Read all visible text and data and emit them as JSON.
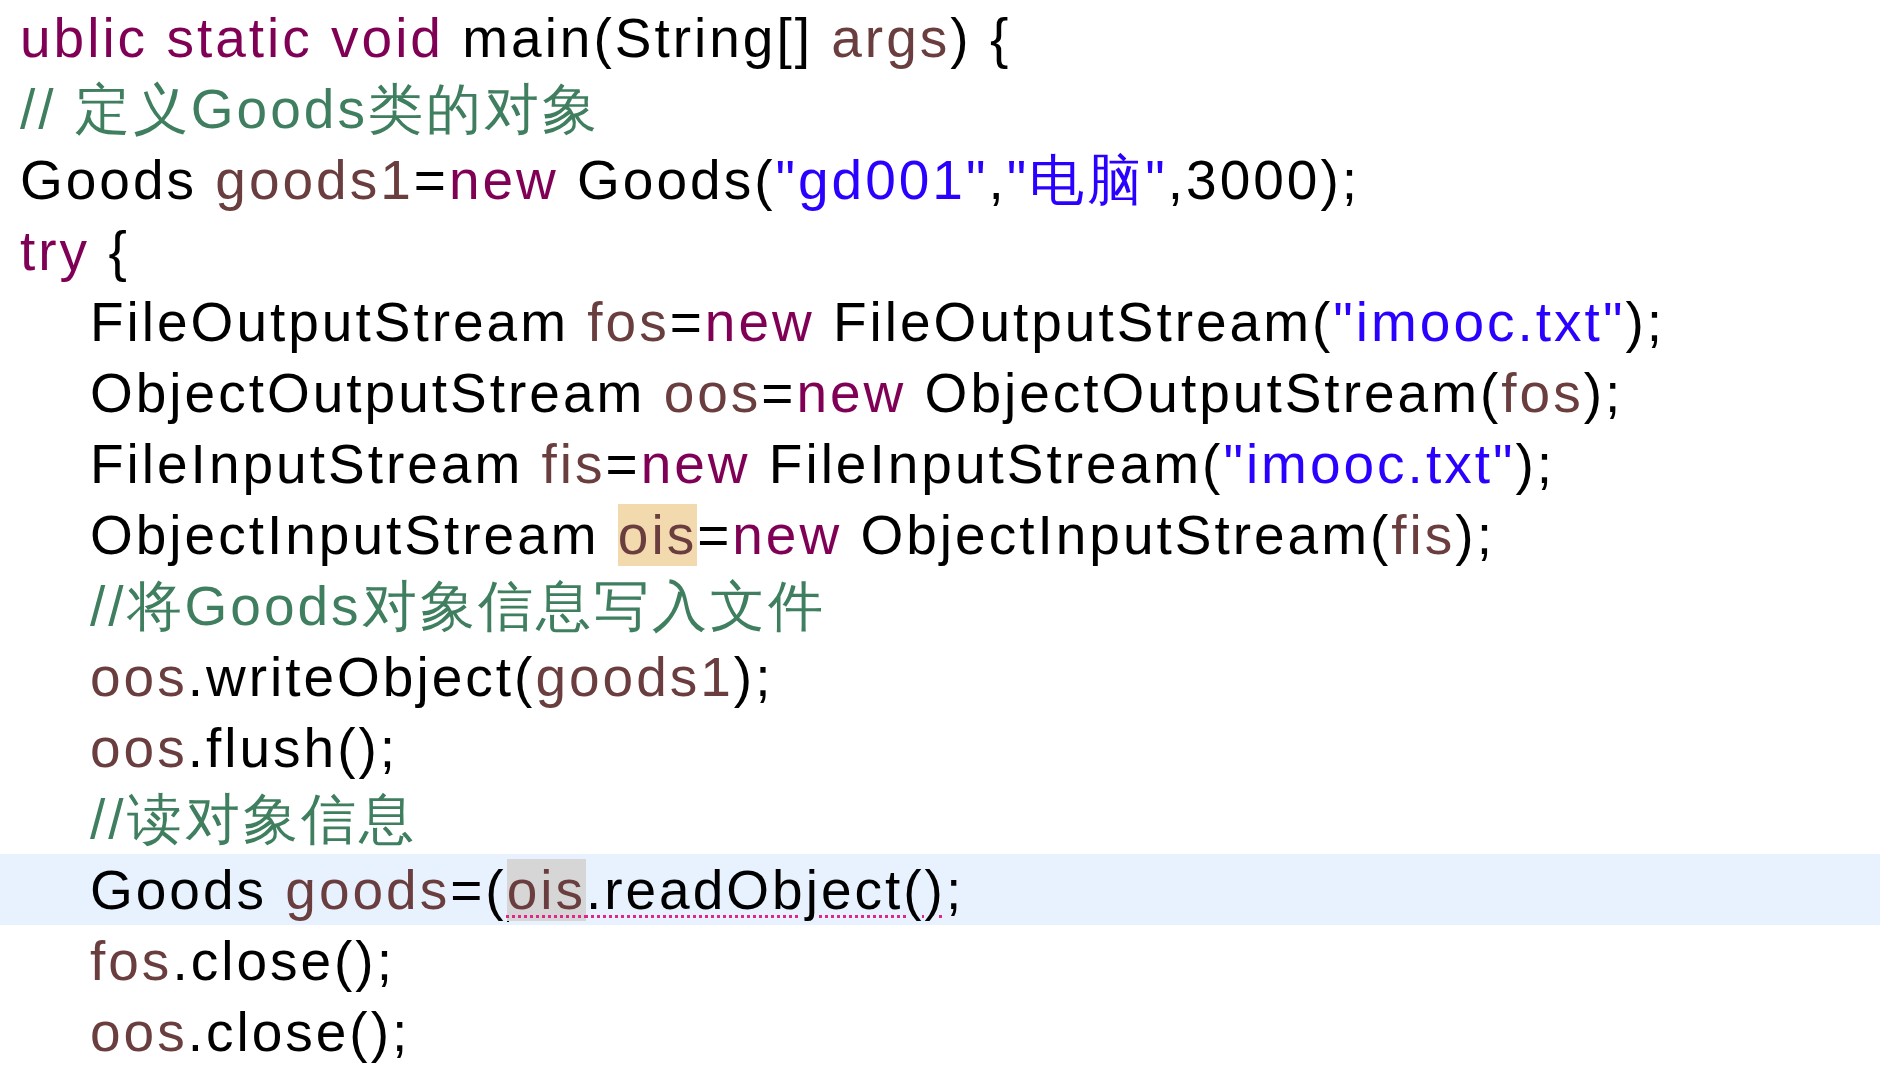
{
  "lines": [
    {
      "current": false,
      "tokens": [
        {
          "kind": "keyword",
          "text": "ublic static void"
        },
        {
          "kind": "plain",
          "text": " main(String[] "
        },
        {
          "kind": "variable",
          "text": "args"
        },
        {
          "kind": "plain",
          "text": ") {"
        }
      ]
    },
    {
      "current": false,
      "tokens": [
        {
          "kind": "comment",
          "text": "// 定义Goods类的对象"
        }
      ]
    },
    {
      "current": false,
      "tokens": [
        {
          "kind": "plain",
          "text": "Goods "
        },
        {
          "kind": "variable",
          "text": "goods1"
        },
        {
          "kind": "plain",
          "text": "="
        },
        {
          "kind": "keyword",
          "text": "new"
        },
        {
          "kind": "plain",
          "text": " Goods("
        },
        {
          "kind": "string",
          "text": "\"gd001\""
        },
        {
          "kind": "plain",
          "text": ","
        },
        {
          "kind": "string",
          "text": "\"电脑\""
        },
        {
          "kind": "plain",
          "text": ",3000);"
        }
      ]
    },
    {
      "current": false,
      "tokens": [
        {
          "kind": "keyword",
          "text": "try"
        },
        {
          "kind": "plain",
          "text": " {"
        }
      ],
      "children": [
        {
          "current": false,
          "tokens": [
            {
              "kind": "plain",
              "text": "FileOutputStream "
            },
            {
              "kind": "variable",
              "text": "fos"
            },
            {
              "kind": "plain",
              "text": "="
            },
            {
              "kind": "keyword",
              "text": "new"
            },
            {
              "kind": "plain",
              "text": " FileOutputStream("
            },
            {
              "kind": "string",
              "text": "\"imooc.txt\""
            },
            {
              "kind": "plain",
              "text": ");"
            }
          ]
        },
        {
          "current": false,
          "tokens": [
            {
              "kind": "plain",
              "text": "ObjectOutputStream "
            },
            {
              "kind": "variable",
              "text": "oos"
            },
            {
              "kind": "plain",
              "text": "="
            },
            {
              "kind": "keyword",
              "text": "new"
            },
            {
              "kind": "plain",
              "text": " ObjectOutputStream("
            },
            {
              "kind": "variable",
              "text": "fos"
            },
            {
              "kind": "plain",
              "text": ");"
            }
          ]
        },
        {
          "current": false,
          "tokens": [
            {
              "kind": "plain",
              "text": "FileInputStream "
            },
            {
              "kind": "variable",
              "text": "fis"
            },
            {
              "kind": "plain",
              "text": "="
            },
            {
              "kind": "keyword",
              "text": "new"
            },
            {
              "kind": "plain",
              "text": " FileInputStream("
            },
            {
              "kind": "string",
              "text": "\"imooc.txt\""
            },
            {
              "kind": "plain",
              "text": ");"
            }
          ]
        },
        {
          "current": false,
          "tokens": [
            {
              "kind": "plain",
              "text": "ObjectInputStream "
            },
            {
              "kind": "occurrence",
              "text": "ois"
            },
            {
              "kind": "plain",
              "text": "="
            },
            {
              "kind": "keyword",
              "text": "new"
            },
            {
              "kind": "plain",
              "text": " ObjectInputStream("
            },
            {
              "kind": "variable",
              "text": "fis"
            },
            {
              "kind": "plain",
              "text": ");"
            }
          ]
        },
        {
          "current": false,
          "tokens": [
            {
              "kind": "comment",
              "text": "//将Goods对象信息写入文件"
            }
          ]
        },
        {
          "current": false,
          "tokens": [
            {
              "kind": "variable",
              "text": "oos"
            },
            {
              "kind": "plain",
              "text": ".writeObject("
            },
            {
              "kind": "variable",
              "text": "goods1"
            },
            {
              "kind": "plain",
              "text": ");"
            }
          ]
        },
        {
          "current": false,
          "tokens": [
            {
              "kind": "variable",
              "text": "oos"
            },
            {
              "kind": "plain",
              "text": ".flush();"
            }
          ]
        },
        {
          "current": false,
          "tokens": [
            {
              "kind": "comment",
              "text": "//读对象信息"
            }
          ]
        },
        {
          "current": true,
          "tokens": [
            {
              "kind": "plain",
              "text": "Goods "
            },
            {
              "kind": "variable",
              "text": "goods"
            },
            {
              "kind": "plain",
              "text": "=("
            },
            {
              "kind": "caret"
            },
            {
              "kind": "error",
              "tokens": [
                {
                  "kind": "selection",
                  "text": "ois"
                },
                {
                  "kind": "plain",
                  "text": ".readObject()"
                }
              ]
            },
            {
              "kind": "plain",
              "text": ";"
            }
          ]
        },
        {
          "current": false,
          "tokens": [
            {
              "kind": "variable",
              "text": "fos"
            },
            {
              "kind": "plain",
              "text": ".close();"
            }
          ]
        },
        {
          "current": false,
          "tokens": [
            {
              "kind": "variable",
              "text": "oos"
            },
            {
              "kind": "plain",
              "text": ".close();"
            }
          ]
        }
      ]
    }
  ]
}
